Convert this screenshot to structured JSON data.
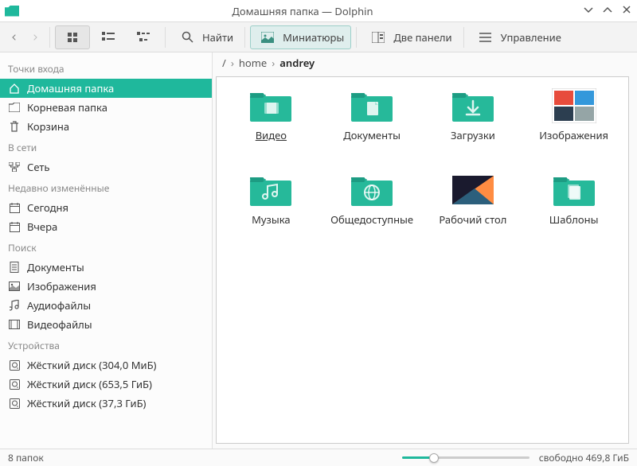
{
  "window": {
    "title": "Домашняя папка — Dolphin"
  },
  "toolbar": {
    "search": "Найти",
    "thumbnails": "Миниатюры",
    "split": "Две панели",
    "control": "Управление"
  },
  "breadcrumb": {
    "root": "/",
    "parts": [
      "home",
      "andrey"
    ]
  },
  "sidebar": {
    "places_title": "Точки входа",
    "places": [
      {
        "label": "Домашняя папка",
        "icon": "home"
      },
      {
        "label": "Корневая папка",
        "icon": "folder"
      },
      {
        "label": "Корзина",
        "icon": "trash"
      }
    ],
    "network_title": "В сети",
    "network": [
      {
        "label": "Сеть",
        "icon": "network"
      }
    ],
    "recent_title": "Недавно изменённые",
    "recent": [
      {
        "label": "Сегодня",
        "icon": "calendar"
      },
      {
        "label": "Вчера",
        "icon": "calendar"
      }
    ],
    "search_title": "Поиск",
    "search": [
      {
        "label": "Документы",
        "icon": "doc"
      },
      {
        "label": "Изображения",
        "icon": "image"
      },
      {
        "label": "Аудиофайлы",
        "icon": "audio"
      },
      {
        "label": "Видеофайлы",
        "icon": "video"
      }
    ],
    "devices_title": "Устройства",
    "devices": [
      {
        "label": "Жёсткий диск (304,0 МиБ)",
        "icon": "hdd"
      },
      {
        "label": "Жёсткий диск (653,5 ГиБ)",
        "icon": "hdd"
      },
      {
        "label": "Жёсткий диск (37,3 ГиБ)",
        "icon": "hdd"
      }
    ]
  },
  "folders": [
    {
      "label": "Видео",
      "type": "video",
      "selected": true
    },
    {
      "label": "Документы",
      "type": "documents"
    },
    {
      "label": "Загрузки",
      "type": "downloads"
    },
    {
      "label": "Изображения",
      "type": "pictures"
    },
    {
      "label": "Музыка",
      "type": "music"
    },
    {
      "label": "Общедоступные",
      "type": "public"
    },
    {
      "label": "Рабочий стол",
      "type": "desktop"
    },
    {
      "label": "Шаблоны",
      "type": "templates"
    }
  ],
  "status": {
    "count": "8 папок",
    "free": "свободно 469,8 ГиБ"
  },
  "colors": {
    "accent": "#1fb89c",
    "folder": "#26b99a",
    "folder_dark": "#1d9c83"
  }
}
